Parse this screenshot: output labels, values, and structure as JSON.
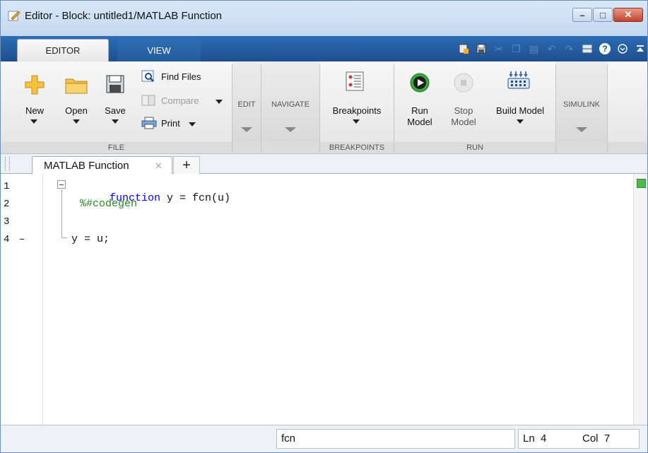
{
  "window": {
    "title": "Editor - Block: untitled1/MATLAB Function"
  },
  "tabs": {
    "editor": "EDITOR",
    "view": "VIEW"
  },
  "ribbon": {
    "file": {
      "label": "FILE",
      "new": "New",
      "open": "Open",
      "save": "Save",
      "find_files": "Find Files",
      "compare": "Compare",
      "print": "Print"
    },
    "edit": {
      "label": "EDIT"
    },
    "navigate": {
      "label": "NAVIGATE"
    },
    "breakpoints": {
      "label": "BREAKPOINTS",
      "button": "Breakpoints"
    },
    "run": {
      "label": "RUN",
      "run_model_1": "Run",
      "run_model_2": "Model",
      "stop_model_1": "Stop",
      "stop_model_2": "Model",
      "build_model": "Build Model"
    },
    "simulink": {
      "label": "SIMULINK"
    }
  },
  "document": {
    "tab_label": "MATLAB Function",
    "close_glyph": "✕",
    "add_glyph": "+"
  },
  "code": {
    "lines": [
      {
        "num": "1",
        "kw": "function",
        "rest": " y = fcn(u)"
      },
      {
        "num": "2",
        "comment": "%#codegen"
      },
      {
        "num": "3"
      },
      {
        "num": "4",
        "dash": "–",
        "text": "y = u;"
      }
    ]
  },
  "status": {
    "function": "fcn",
    "ln_label": "Ln",
    "ln_value": "4",
    "col_label": "Col",
    "col_value": "7"
  },
  "colors": {
    "keyword": "#0000ff",
    "comment": "#228b22",
    "tab_strip": "#2e6db5",
    "ok_marker": "#4cbb4c"
  }
}
